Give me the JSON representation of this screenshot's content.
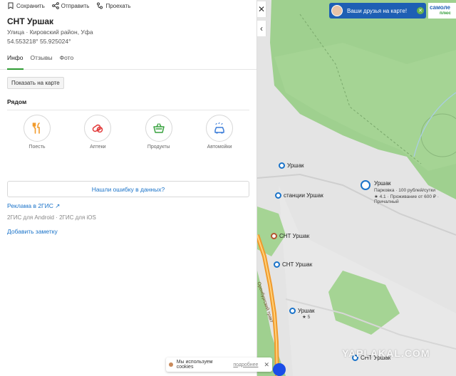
{
  "toolbar": {
    "save": "Сохранить",
    "share": "Отправить",
    "route": "Проехать"
  },
  "place": {
    "title": "СНТ Уршак",
    "subtitle": "Улица · Кировский район, Уфа",
    "coords": "54.553218° 55.925024°"
  },
  "tabs": [
    {
      "label": "Инфо",
      "active": true
    },
    {
      "label": "Отзывы",
      "active": false
    },
    {
      "label": "Фото",
      "active": false
    }
  ],
  "show_on_map": "Показать на карте",
  "nearby": {
    "title": "Рядом",
    "items": [
      {
        "label": "Поесть",
        "icon": "fork-knife-icon",
        "color": "#f29b2b"
      },
      {
        "label": "Аптеки",
        "icon": "pill-icon",
        "color": "#e23a3a"
      },
      {
        "label": "Продукты",
        "icon": "basket-icon",
        "color": "#38a23f"
      },
      {
        "label": "Автомойки",
        "icon": "car-wash-icon",
        "color": "#3b7dd8"
      }
    ]
  },
  "report_error": "Нашли ошибку в данных?",
  "ad_link": "Реклама в 2ГИС ↗",
  "apps": {
    "android": "2ГИС для Android",
    "sep": " · ",
    "ios": "2ГИС для iOS"
  },
  "add_note": "Добавить заметку",
  "map": {
    "promo": "Ваши друзья на карте!",
    "brand_top": "самоле",
    "brand_bottom": "плюс",
    "labels": {
      "ursak1": "Уршак",
      "station": "станции Уршак",
      "ursak_parking": "Уршак",
      "parking_line1": "Парковка · 100 рублей/сутки",
      "parking_line2": "★ 4.1 · Проживание от 600 ₽ ·",
      "parking_line3": "Причалный",
      "snt1": "СНТ Уршак",
      "snt2": "СНТ Уршак",
      "ursak2": "Уршак",
      "ursak2_sub": "★ 5",
      "snt3": "СНТ Уршак",
      "road": "Оренбургский тракт"
    },
    "colors": {
      "forest": "#9fd08f",
      "field": "#e4e4e4",
      "road": "#f09a2c",
      "water": "#aacde8"
    }
  },
  "cookie": {
    "text": "Мы используем cookies",
    "more": "подробнее",
    "close": "✕"
  },
  "watermark": "YAPLAKAL.COM"
}
